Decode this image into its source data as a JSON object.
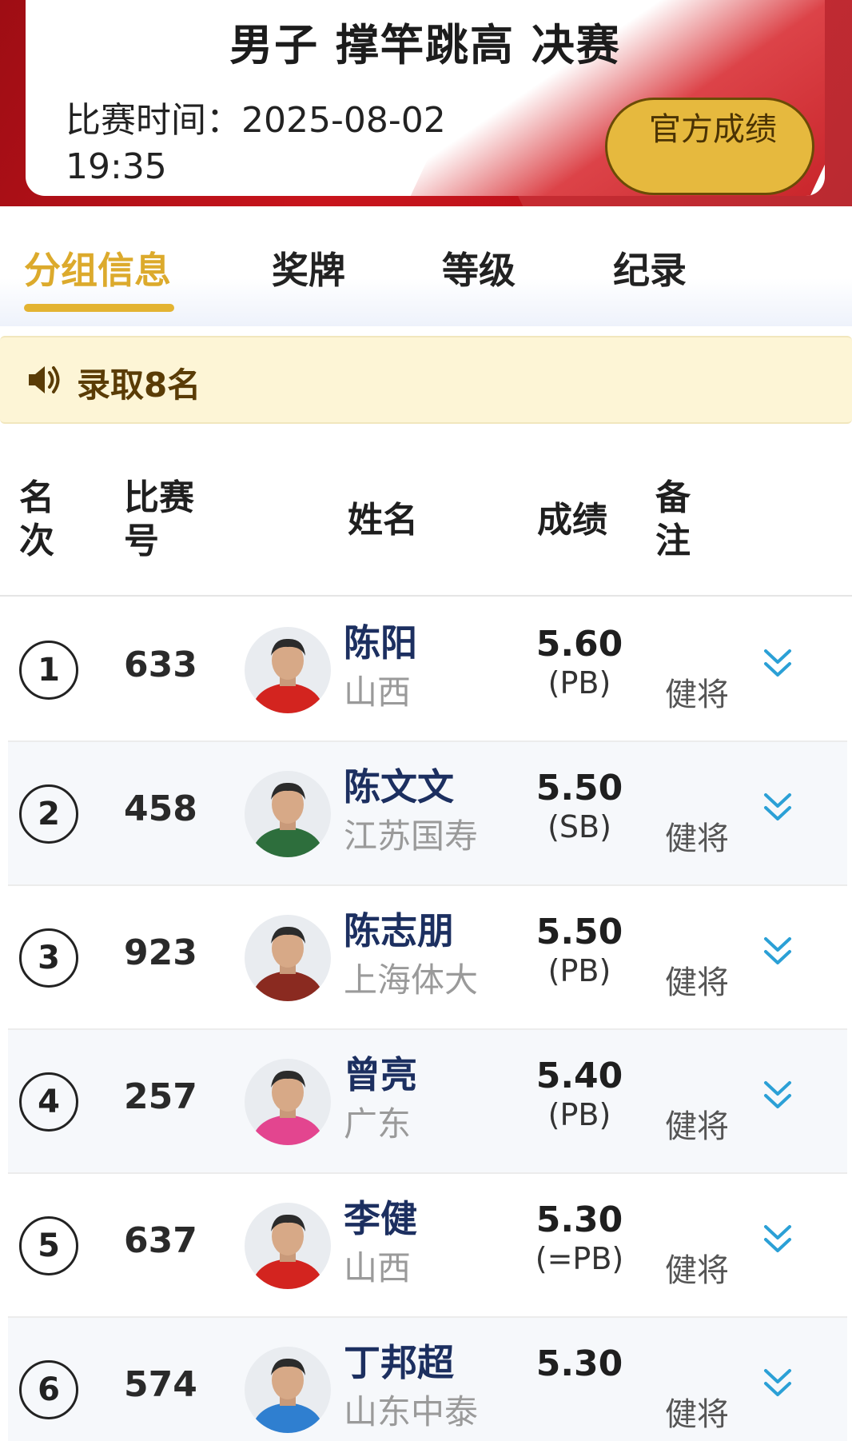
{
  "header": {
    "title": "男子 撑竿跳高 决赛",
    "time_label": "比赛时间：",
    "time_value": "2025-08-02 19:35",
    "official_button": "官方成绩"
  },
  "tabs": [
    {
      "label": "分组信息",
      "active": true
    },
    {
      "label": "奖牌",
      "active": false
    },
    {
      "label": "等级",
      "active": false
    },
    {
      "label": "纪录",
      "active": false
    }
  ],
  "notice": {
    "icon": "speaker-icon",
    "text": "录取8名"
  },
  "table": {
    "headers": {
      "rank": "名次",
      "bib": "比赛号",
      "name": "姓名",
      "result": "成绩",
      "remark": "备注"
    },
    "rows": [
      {
        "rank": "1",
        "bib": "633",
        "name": "陈阳",
        "team": "山西",
        "result": "5.60",
        "note": "(PB)",
        "remark": "健将"
      },
      {
        "rank": "2",
        "bib": "458",
        "name": "陈文文",
        "team": "江苏国寿",
        "result": "5.50",
        "note": "(SB)",
        "remark": "健将"
      },
      {
        "rank": "3",
        "bib": "923",
        "name": "陈志朋",
        "team": "上海体大",
        "result": "5.50",
        "note": "(PB)",
        "remark": "健将"
      },
      {
        "rank": "4",
        "bib": "257",
        "name": "曾亮",
        "team": "广东",
        "result": "5.40",
        "note": "(PB)",
        "remark": "健将"
      },
      {
        "rank": "5",
        "bib": "637",
        "name": "李健",
        "team": "山西",
        "result": "5.30",
        "note": "(=PB)",
        "remark": "健将"
      },
      {
        "rank": "6",
        "bib": "574",
        "name": "丁邦超",
        "team": "山东中泰",
        "result": "5.30",
        "note": "",
        "remark": "健将"
      }
    ]
  },
  "colors": {
    "brand_red": "#c8141c",
    "active_tab": "#dcaa2c",
    "official_button": "#e6b93e",
    "name_text": "#1c2f60",
    "expand_icon": "#2ba0d6"
  }
}
